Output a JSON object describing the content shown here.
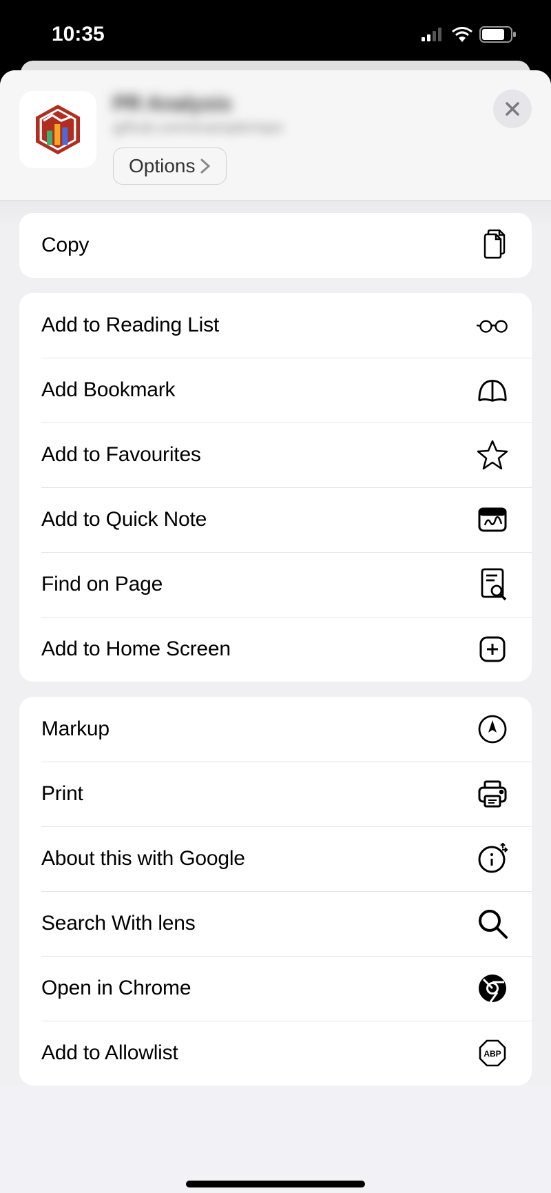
{
  "status": {
    "time": "10:35"
  },
  "header": {
    "title": "PR Analysis",
    "subtitle": "github.com/example/repo",
    "options_label": "Options"
  },
  "groups": [
    {
      "items": [
        {
          "label": "Copy",
          "icon": "copy-icon"
        }
      ]
    },
    {
      "items": [
        {
          "label": "Add to Reading List",
          "icon": "reading-list-icon"
        },
        {
          "label": "Add Bookmark",
          "icon": "bookmark-icon"
        },
        {
          "label": "Add to Favourites",
          "icon": "star-icon"
        },
        {
          "label": "Add to Quick Note",
          "icon": "quick-note-icon"
        },
        {
          "label": "Find on Page",
          "icon": "find-on-page-icon"
        },
        {
          "label": "Add to Home Screen",
          "icon": "add-home-icon"
        }
      ]
    },
    {
      "items": [
        {
          "label": "Markup",
          "icon": "markup-icon"
        },
        {
          "label": "Print",
          "icon": "print-icon"
        },
        {
          "label": "About this with Google",
          "icon": "about-google-icon"
        },
        {
          "label": "Search With lens",
          "icon": "search-lens-icon"
        },
        {
          "label": "Open in Chrome",
          "icon": "chrome-icon"
        },
        {
          "label": "Add to Allowlist",
          "icon": "abp-icon"
        }
      ]
    }
  ]
}
